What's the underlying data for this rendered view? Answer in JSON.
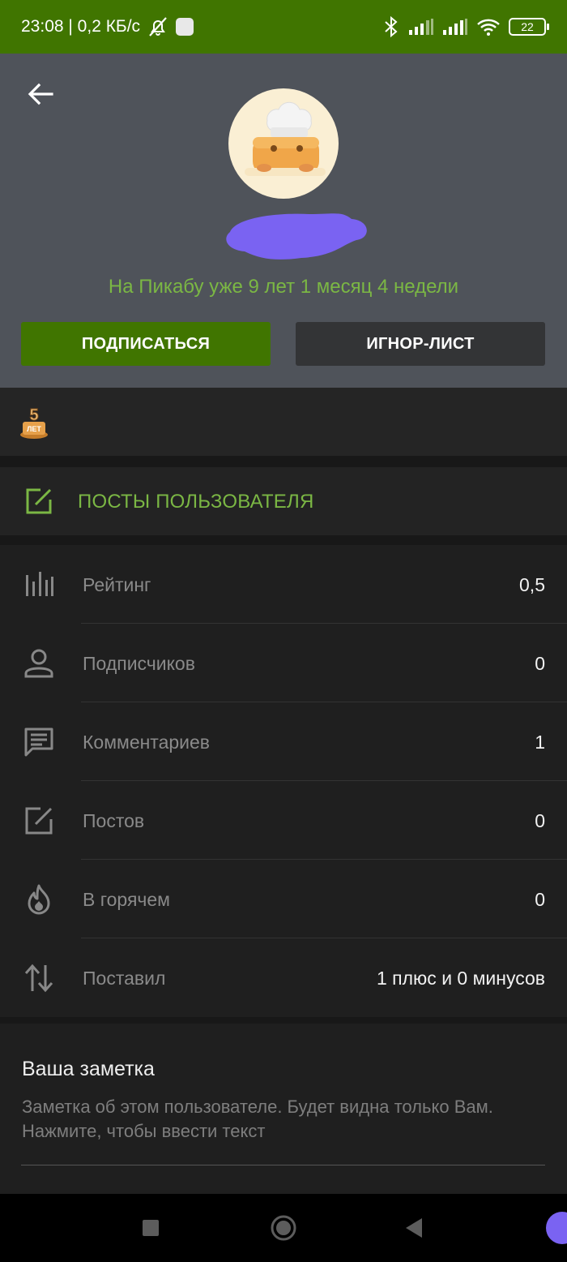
{
  "status_bar": {
    "time_and_speed": "23:08 | 0,2 КБ/с",
    "battery": "22"
  },
  "profile": {
    "since_text": "На Пикабу уже 9 лет 1 месяц 4 недели",
    "subscribe_label": "ПОДПИСАТЬСЯ",
    "ignore_label": "ИГНОР-ЛИСТ"
  },
  "award": {
    "icon": "5-years-badge-icon",
    "text": "5 лет"
  },
  "posts_link": {
    "label": "ПОСТЫ ПОЛЬЗОВАТЕЛЯ"
  },
  "stats": [
    {
      "icon": "bar-chart-icon",
      "label": "Рейтинг",
      "value": "0,5"
    },
    {
      "icon": "person-icon",
      "label": "Подписчиков",
      "value": "0"
    },
    {
      "icon": "comment-icon",
      "label": "Комментариев",
      "value": "1"
    },
    {
      "icon": "edit-post-icon",
      "label": "Постов",
      "value": "0"
    },
    {
      "icon": "fire-icon",
      "label": "В горячем",
      "value": "0"
    },
    {
      "icon": "up-down-arrows-icon",
      "label": "Поставил",
      "value": "1 плюс и 0 минусов"
    }
  ],
  "note": {
    "title": "Ваша заметка",
    "hint": "Заметка об этом пользователе. Будет видна только Вам. Нажмите, чтобы ввести текст"
  },
  "colors": {
    "accent_green": "#407500",
    "text_green": "#7bb744",
    "header_bg": "#4f535a",
    "redaction_purple": "#7a63f2"
  }
}
